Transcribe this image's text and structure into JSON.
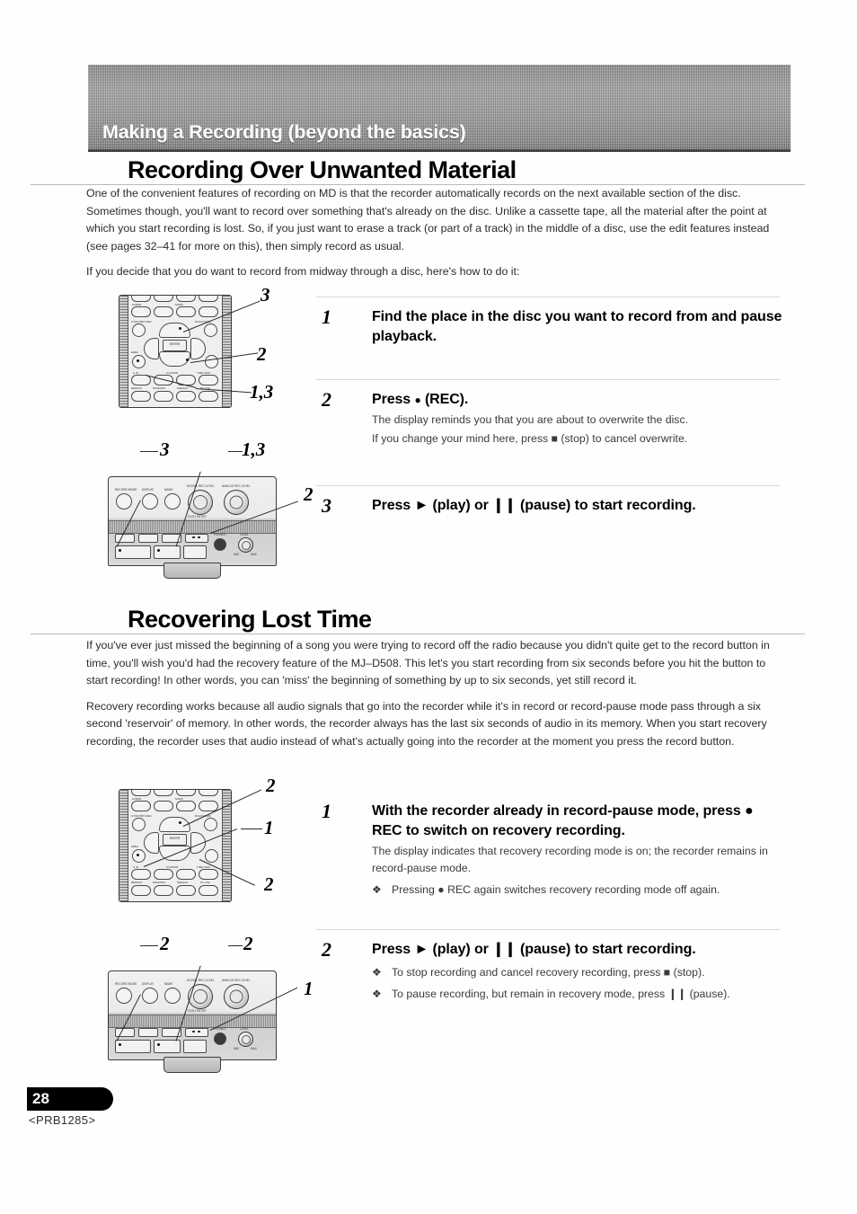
{
  "banner": {
    "title": "Making a Recording (beyond the basics)"
  },
  "sections": [
    {
      "heading": "Recording Over Unwanted Material",
      "paragraphs": [
        "One of the convenient features of recording on MD is that the recorder automatically records on the next available section of the disc. Sometimes though, you'll want to record over something that's already on the disc. Unlike a cassette tape, all the material after the point at which you start recording is lost. So, if you just want to erase a track (or part of a track) in the middle of a disc, use the edit features instead (see pages 32–41 for more on this), then simply record as usual.",
        "If you decide that you do want to record from midway through a disc, here's how to do it:"
      ],
      "steps": [
        {
          "number": "1",
          "title": "Find the place in the disc you want to record from and pause playback.",
          "notes": [],
          "bullets": []
        },
        {
          "number": "2",
          "title_pre": "Press ",
          "title_glyph": "●",
          "title_post": " (REC).",
          "title": "Press ● (REC).",
          "notes": [
            "The display reminds you that you are about to overwrite the disc.",
            "If you change your mind here, press ■ (stop) to cancel overwrite."
          ],
          "bullets": []
        },
        {
          "number": "3",
          "title": "Press ► (play) or ❙❙ (pause) to start recording.",
          "notes": [],
          "bullets": []
        }
      ]
    },
    {
      "heading": "Recovering Lost Time",
      "paragraphs": [
        "If you've ever just missed the beginning of a song you were trying to record off the radio because you didn't quite get to the record button in time, you'll wish you'd had the recovery feature of the MJ–D508. This let's you start recording from six seconds before you hit the button to start recording! In other words, you can 'miss' the beginning of something by up to six seconds, yet still record it.",
        "Recovery recording works because all audio signals that go into the recorder while it's in record or record-pause mode pass through a six second 'reservoir' of memory. In other words, the recorder always has the last six seconds of audio in its memory. When you start recovery recording, the recorder uses that audio instead of what's actually going into the recorder at the moment you press the record button."
      ],
      "steps": [
        {
          "number": "1",
          "title": "With the recorder already in record-pause mode, press ● REC to switch on recovery recording.",
          "notes": [
            "The display indicates that recovery recording mode is on; the recorder remains in record-pause mode."
          ],
          "bullets": [
            "Pressing ● REC again switches recovery recording mode off again."
          ]
        },
        {
          "number": "2",
          "title": "Press ► (play) or ❙❙ (pause) to start recording.",
          "notes": [],
          "bullets": [
            "To stop recording and cancel recovery recording, press ■ (stop).",
            "To pause recording, but remain in recovery mode, press ❙❙ (pause)."
          ]
        }
      ]
    }
  ],
  "diagrams": {
    "remote_top": {
      "name": "remote-control-unit",
      "labels": {
        "fader": "FADER",
        "mark": "MARK",
        "plus10": "+10",
        "tenzero": "10/0",
        "gt10": ">10",
        "seven": "7",
        "eight": "8",
        "nine": "9",
        "synchro_rec": "SYNCHRO REC",
        "digi_chara": "DIGI/CHARA",
        "rec": "● REC",
        "enter": "ENTER",
        "ab": "A–B",
        "cursor": "CURSOR",
        "time_skip": "TIME SKIP",
        "repeat": "REPEAT",
        "random": "RANDOM",
        "medley": "MEDLEY",
        "hilite": "HI-LITE"
      },
      "callouts": [
        "3",
        "2",
        "1,3"
      ]
    },
    "panel_top": {
      "name": "front-panel",
      "labels": {
        "record_mode": "RECORD MODE",
        "display": "DISPLAY",
        "name": "NAME",
        "digital_rec_level": "DIGITAL REC LEVEL",
        "analog_rec_level": "ANALOG REC LEVEL",
        "push_enter": "PUSH ENTER",
        "phones": "PHONES",
        "level": "LEVEL",
        "min": "MIN",
        "max": "MAX"
      },
      "callouts": [
        "3",
        "1,3",
        "2"
      ]
    },
    "remote_bottom": {
      "name": "remote-control-unit",
      "callouts": [
        "2",
        "1",
        "2"
      ]
    },
    "panel_bottom": {
      "name": "front-panel",
      "callouts": [
        "2",
        "2",
        "1"
      ]
    }
  },
  "footer": {
    "page_number": "28",
    "document_code": "<PRB1285>"
  }
}
